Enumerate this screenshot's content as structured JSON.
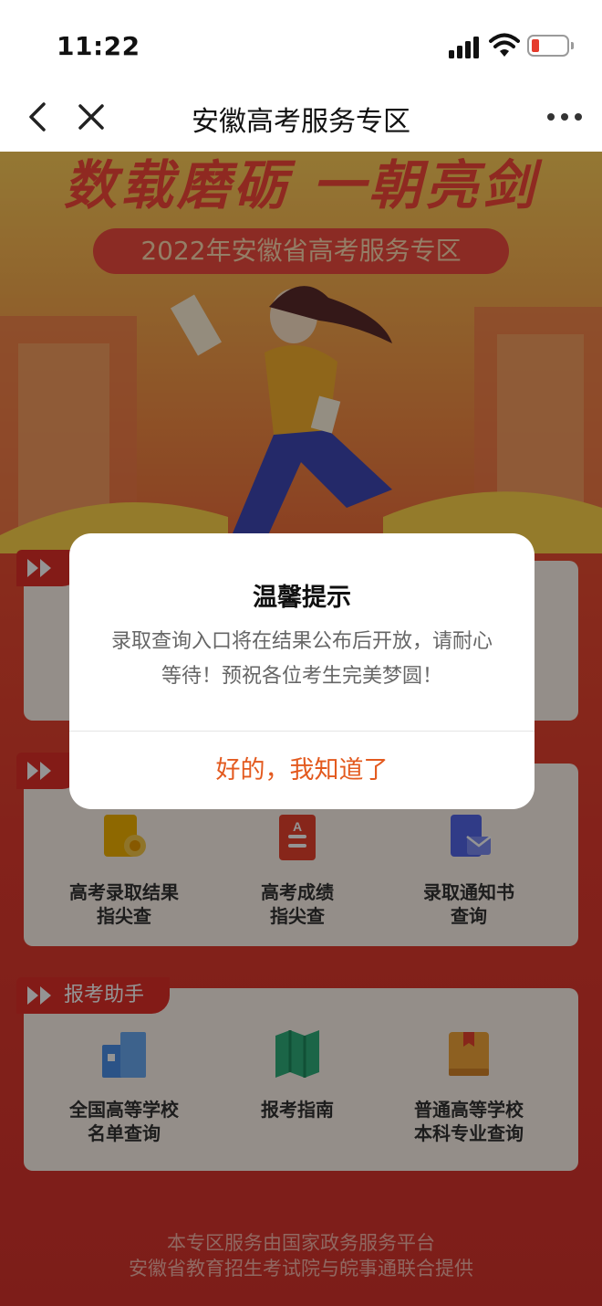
{
  "status_bar": {
    "time": "11:22"
  },
  "nav": {
    "title": "安徽高考服务专区"
  },
  "banner": {
    "slogan": "数载磨砺 一朝亮剑",
    "subtitle": "2022年安徽省高考服务专区"
  },
  "section2": {
    "items": [
      {
        "label": "高考录取结果\n指尖查",
        "icon": "certificate-icon"
      },
      {
        "label": "高考成绩\n指尖查",
        "icon": "score-document-icon"
      },
      {
        "label": "录取通知书\n查询",
        "icon": "admission-letter-icon"
      }
    ]
  },
  "section3": {
    "tag": "报考助手",
    "items": [
      {
        "label": "全国高等学校\n名单查询",
        "icon": "building-icon"
      },
      {
        "label": "报考指南",
        "icon": "map-guide-icon"
      },
      {
        "label": "普通高等学校\n本科专业查询",
        "icon": "book-icon"
      }
    ]
  },
  "footer": {
    "line1": "本专区服务由国家政务服务平台",
    "line2": "安徽省教育招生考试院与皖事通联合提供"
  },
  "dialog": {
    "title": "温馨提示",
    "message": "录取查询入口将在结果公布后开放，请耐心等待！预祝各位考生完美梦圆！",
    "confirm": "好的，我知道了"
  },
  "colors": {
    "accent": "#e35a1f",
    "section_tag": "#e22f28",
    "battery_low": "#e53b2c"
  }
}
